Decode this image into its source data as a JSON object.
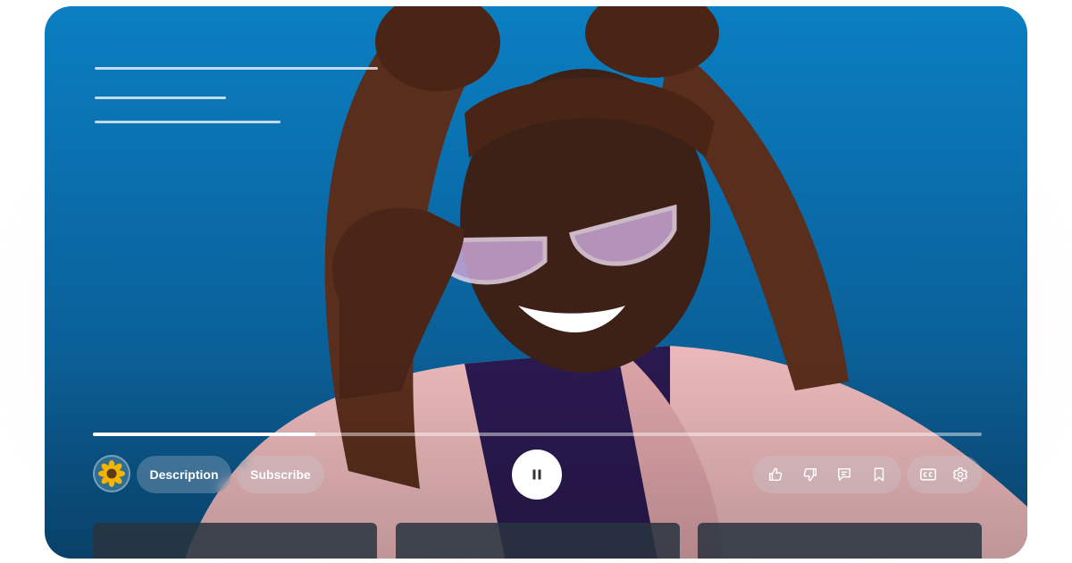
{
  "player": {
    "progress": 0.25,
    "description_label": "Description",
    "subscribe_label": "Subscribe",
    "state": "playing"
  },
  "icons": {
    "pause": "pause-icon",
    "like": "thumbs-up-icon",
    "dislike": "thumbs-down-icon",
    "comment": "comment-icon",
    "save": "bookmark-icon",
    "captions": "closed-captions-icon",
    "settings": "gear-icon",
    "avatar": "sunflower-avatar-icon"
  },
  "colors": {
    "background_blue": "#0a6aa7",
    "control_white": "#ffffff",
    "glow_pink": "#ffb4c0"
  }
}
